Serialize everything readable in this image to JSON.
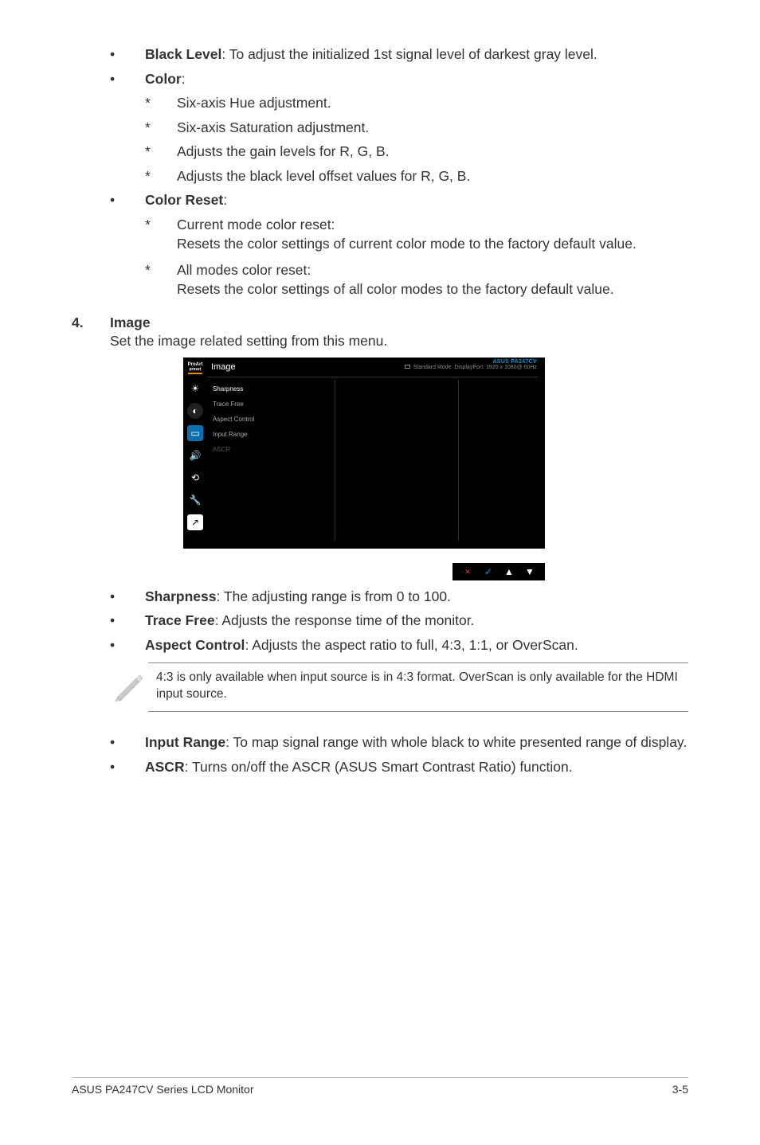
{
  "bullets_top": [
    {
      "label_bold": "Black Level",
      "label_rest": ": To adjust the initialized 1st signal level of darkest gray level."
    },
    {
      "label_bold": "Color",
      "label_rest": ":"
    }
  ],
  "color_subs": [
    "Six-axis Hue adjustment.",
    "Six-axis Saturation adjustment.",
    "Adjusts the gain levels for R, G, B.",
    "Adjusts the black level offset values for R, G, B."
  ],
  "color_reset": {
    "head_bold": "Color Reset",
    "head_rest": ":",
    "items": [
      {
        "title": "Current mode color reset:",
        "desc": "Resets the color settings of current color mode to the factory default value."
      },
      {
        "title": "All modes color reset:",
        "desc": "Resets the color settings of all color modes to the factory default value."
      }
    ]
  },
  "section4": {
    "num": "4.",
    "title": "Image",
    "subtitle": "Set the image related setting from this menu."
  },
  "osd": {
    "title": "Image",
    "model": "ASUS PA247CV",
    "meta_mode": "Standard Mode",
    "meta_input": "DisplayPort",
    "meta_res": "1920 x 1080@ 60Hz",
    "items": [
      "Sharpness",
      "Trace Free",
      "Aspect Control",
      "Input Range",
      "ASCR"
    ],
    "nav": {
      "x": "×",
      "check": "✓",
      "up": "▲",
      "down": "▼"
    },
    "icons": [
      "brightness",
      "color",
      "image",
      "sound",
      "input",
      "system",
      "shortcut"
    ]
  },
  "bullets_bottom": [
    {
      "label_bold": "Sharpness",
      "label_rest": ": The adjusting range is from 0 to 100."
    },
    {
      "label_bold": "Trace Free",
      "label_rest": ": Adjusts the response time of the monitor."
    },
    {
      "label_bold": "Aspect Control",
      "label_rest": ": Adjusts the aspect ratio to full, 4:3, 1:1, or OverScan."
    }
  ],
  "note": "4:3 is only available when input source is in 4:3 format. OverScan is only available for the HDMI input source.",
  "bullets_after_note": [
    {
      "label_bold": "Input Range",
      "label_rest": ": To map signal range with whole black to white presented range of display."
    },
    {
      "label_bold": "ASCR",
      "label_rest": ": Turns on/off the ASCR (ASUS Smart Contrast Ratio) function."
    }
  ],
  "footer": {
    "left": "ASUS PA247CV Series LCD Monitor",
    "right": "3-5"
  }
}
